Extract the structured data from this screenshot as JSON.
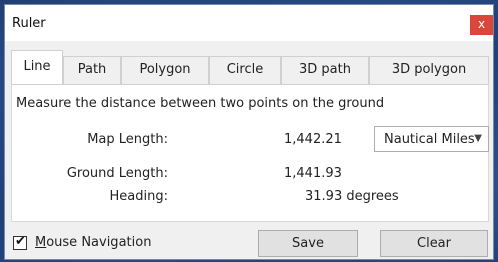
{
  "window": {
    "title": "Ruler",
    "close_glyph": "x"
  },
  "tabs": [
    {
      "label": "Line",
      "active": true
    },
    {
      "label": "Path",
      "active": false
    },
    {
      "label": "Polygon",
      "active": false
    },
    {
      "label": "Circle",
      "active": false
    },
    {
      "label": "3D path",
      "active": false
    },
    {
      "label": "3D polygon",
      "active": false
    }
  ],
  "panel": {
    "description": "Measure the distance between two points on the ground",
    "map_length_label": "Map Length:",
    "map_length_value": "1,442.21",
    "unit_selected": "Nautical Miles",
    "ground_length_label": "Ground Length:",
    "ground_length_value": "1,441.93",
    "heading_label": "Heading:",
    "heading_value": "31.93 degrees"
  },
  "footer": {
    "mouse_nav_label": "Mouse Navigation",
    "mouse_nav_checked": true,
    "save_label": "Save",
    "clear_label": "Clear"
  },
  "colors": {
    "close_button": "#d9473a",
    "background": "#f0f0f0"
  },
  "icons": {
    "close": "close-icon",
    "dropdown": "chevron-down-icon",
    "check": "check-icon"
  }
}
